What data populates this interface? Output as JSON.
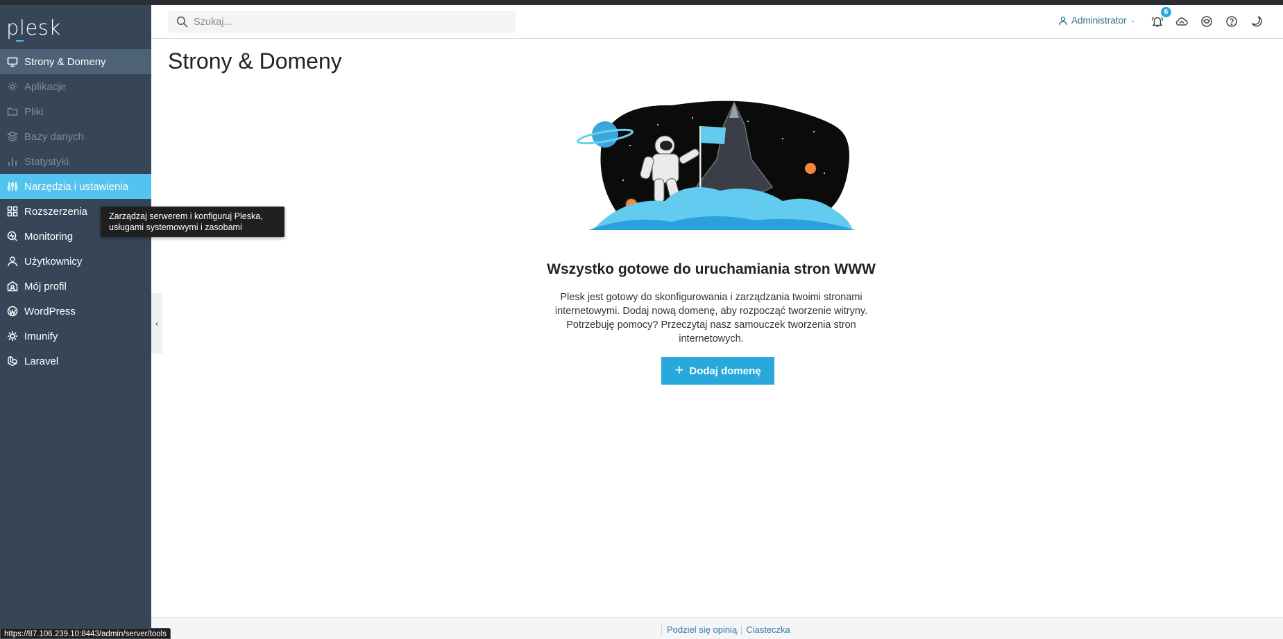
{
  "app": {
    "logo_text": "plesk"
  },
  "search": {
    "placeholder": "Szukaj..."
  },
  "header": {
    "user_label": "Administrator",
    "notifications_count": "6"
  },
  "sidebar": {
    "items": [
      {
        "label": "Strony & Domeny",
        "icon": "monitor-icon",
        "state": "current"
      },
      {
        "label": "Aplikacje",
        "icon": "gear-icon",
        "state": "disabled"
      },
      {
        "label": "Pliki",
        "icon": "folder-icon",
        "state": "disabled"
      },
      {
        "label": "Bazy danych",
        "icon": "database-icon",
        "state": "disabled"
      },
      {
        "label": "Statystyki",
        "icon": "bar-chart-icon",
        "state": "disabled"
      },
      {
        "label": "Narzędzia i ustawienia",
        "icon": "sliders-icon",
        "state": "hover"
      },
      {
        "label": "Rozszerzenia",
        "icon": "extensions-icon",
        "state": "normal"
      },
      {
        "label": "Monitoring",
        "icon": "monitoring-icon",
        "state": "normal"
      },
      {
        "label": "Użytkownicy",
        "icon": "user-icon",
        "state": "normal"
      },
      {
        "label": "Mój profil",
        "icon": "profile-icon",
        "state": "normal"
      },
      {
        "label": "WordPress",
        "icon": "wordpress-icon",
        "state": "normal"
      },
      {
        "label": "Imunify",
        "icon": "imunify-icon",
        "state": "normal"
      },
      {
        "label": "Laravel",
        "icon": "laravel-icon",
        "state": "normal"
      }
    ],
    "tooltip": "Zarządzaj serwerem i konfiguruj Pleska, usługami systemowymi i zasobami"
  },
  "main": {
    "page_title": "Strony & Domeny",
    "empty_title": "Wszystko gotowe do uruchamiania stron WWW",
    "empty_text": "Plesk jest gotowy do skonfigurowania i zarządzania twoimi stronami internetowymi. Dodaj nową domenę, aby rozpocząć tworzenie witryny. Potrzebuję pomocy? Przeczytaj nasz samouczek tworzenia stron internetowych.",
    "add_button_label": "Dodaj domenę"
  },
  "footer": {
    "feedback_link": "Podziel się opinią",
    "cookies_link": "Ciasteczka"
  },
  "status_bar": {
    "url": "https://87.106.239.10:8443/admin/server/tools"
  },
  "colors": {
    "sidebar_bg": "#364657",
    "sidebar_hover": "#53c3ef",
    "sidebar_current": "#4d6277",
    "accent": "#28a8dc"
  }
}
